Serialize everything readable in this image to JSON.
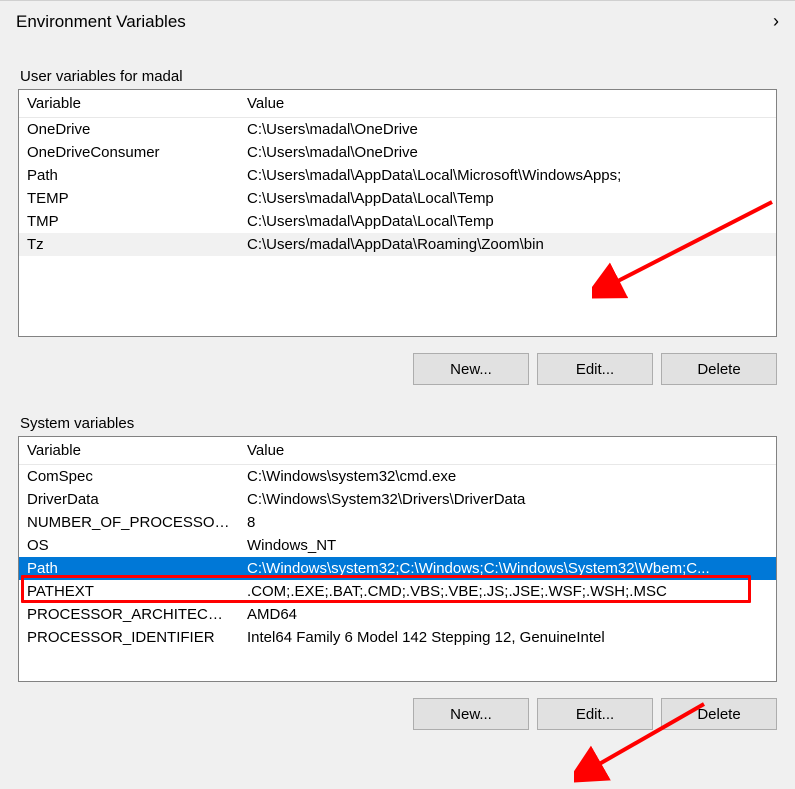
{
  "window": {
    "title": "Environment Variables"
  },
  "user_section": {
    "label": "User variables for madal",
    "columns": {
      "variable": "Variable",
      "value": "Value"
    },
    "rows": [
      {
        "variable": "OneDrive",
        "value": "C:\\Users\\madal\\OneDrive"
      },
      {
        "variable": "OneDriveConsumer",
        "value": "C:\\Users\\madal\\OneDrive"
      },
      {
        "variable": "Path",
        "value": "C:\\Users\\madal\\AppData\\Local\\Microsoft\\WindowsApps;"
      },
      {
        "variable": "TEMP",
        "value": "C:\\Users\\madal\\AppData\\Local\\Temp"
      },
      {
        "variable": "TMP",
        "value": "C:\\Users\\madal\\AppData\\Local\\Temp"
      },
      {
        "variable": "Tz",
        "value": "C:\\Users/madal\\AppData\\Roaming\\Zoom\\bin"
      }
    ],
    "alt_index": 5,
    "buttons": {
      "new": "New...",
      "edit": "Edit...",
      "delete": "Delete"
    }
  },
  "system_section": {
    "label": "System variables",
    "columns": {
      "variable": "Variable",
      "value": "Value"
    },
    "rows": [
      {
        "variable": "ComSpec",
        "value": "C:\\Windows\\system32\\cmd.exe"
      },
      {
        "variable": "DriverData",
        "value": "C:\\Windows\\System32\\Drivers\\DriverData"
      },
      {
        "variable": "NUMBER_OF_PROCESSORS",
        "value": "8"
      },
      {
        "variable": "OS",
        "value": "Windows_NT"
      },
      {
        "variable": "Path",
        "value": "C:\\Windows\\system32;C:\\Windows;C:\\Windows\\System32\\Wbem;C..."
      },
      {
        "variable": "PATHEXT",
        "value": ".COM;.EXE;.BAT;.CMD;.VBS;.VBE;.JS;.JSE;.WSF;.WSH;.MSC"
      },
      {
        "variable": "PROCESSOR_ARCHITECTURE",
        "value": "AMD64"
      },
      {
        "variable": "PROCESSOR_IDENTIFIER",
        "value": "Intel64 Family 6 Model 142 Stepping 12, GenuineIntel"
      }
    ],
    "selected_index": 4,
    "buttons": {
      "new": "New...",
      "edit": "Edit...",
      "delete": "Delete"
    }
  }
}
